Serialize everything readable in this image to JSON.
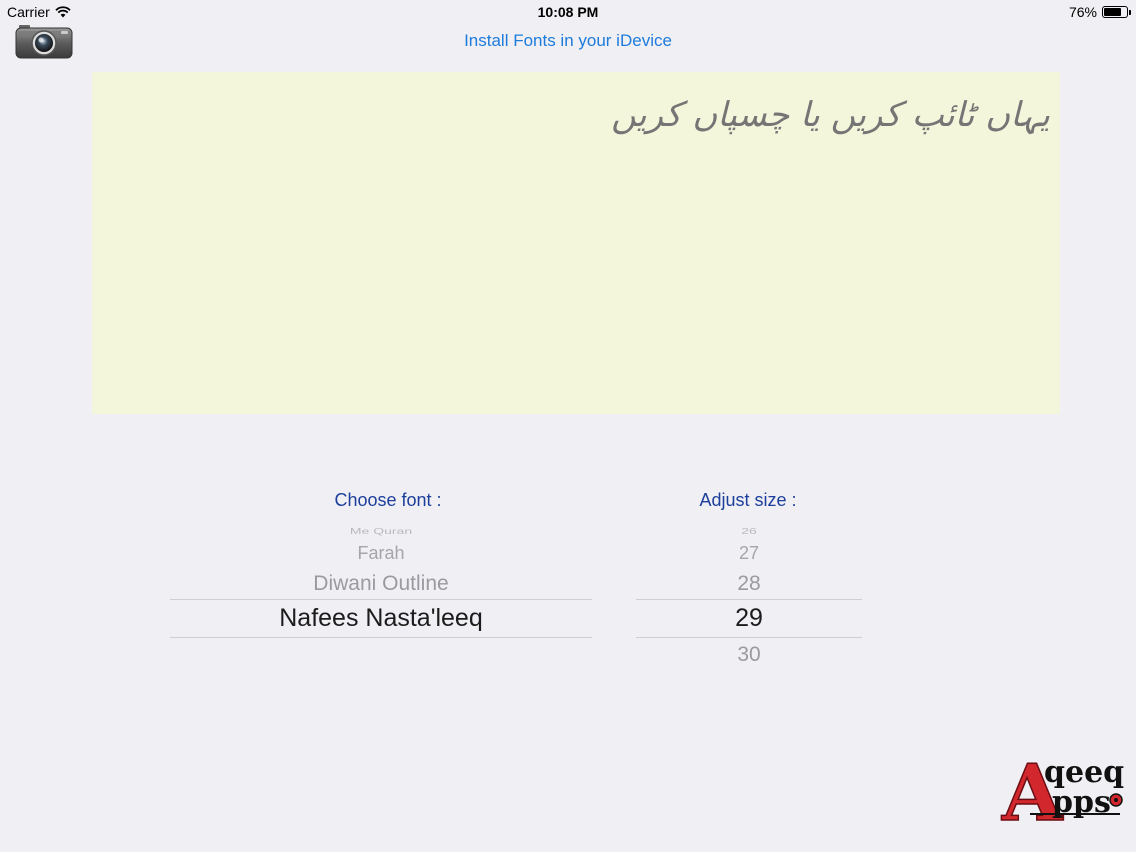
{
  "status_bar": {
    "carrier": "Carrier",
    "time": "10:08 PM",
    "battery": "76%",
    "battery_level": 0.76
  },
  "header": {
    "install_link": "Install Fonts in your iDevice",
    "camera_icon": "camera-icon"
  },
  "editor": {
    "placeholder": "یہاں ٹائپ کریں یا چسپاں کریں"
  },
  "font_picker": {
    "label": "Choose font :",
    "items": [
      "Me Quran",
      "Farah",
      "Diwani Outline",
      "Nafees Nasta'leeq"
    ],
    "selected": "Nafees Nasta'leeq"
  },
  "size_picker": {
    "label": "Adjust size :",
    "items": [
      "26",
      "27",
      "28",
      "29",
      "30"
    ],
    "selected": "29"
  },
  "logo": {
    "line1": "qeeq",
    "line2": "pps",
    "initial": "A",
    "accent": "#d3272e"
  },
  "colors": {
    "link": "#1e7bdc",
    "label": "#1d3f9c",
    "editor_bg": "#f4f6dc",
    "background": "#efeff4"
  }
}
